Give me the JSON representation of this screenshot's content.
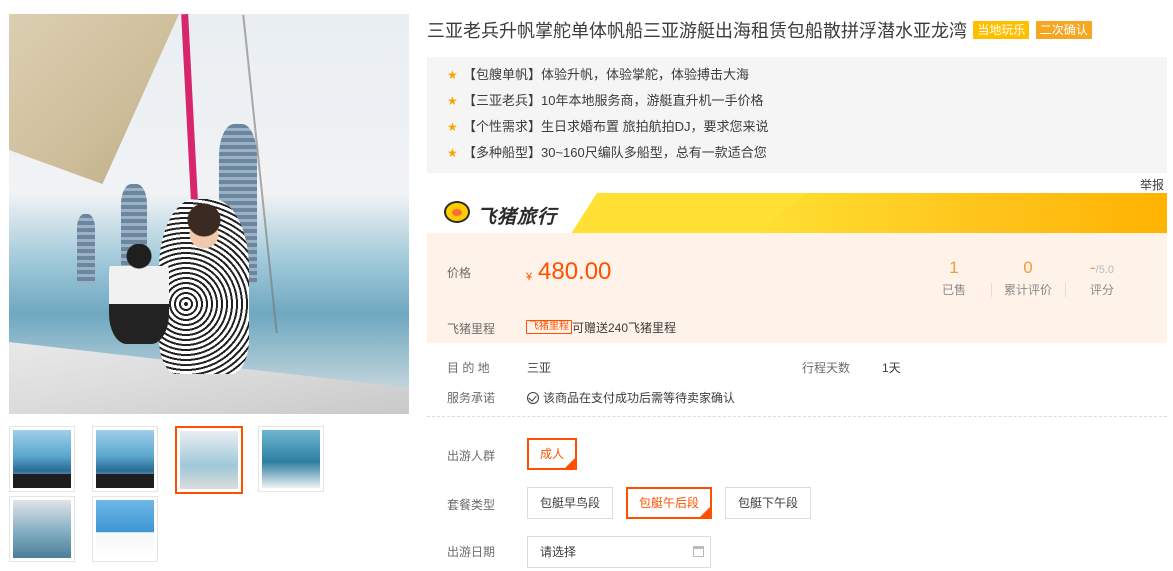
{
  "product": {
    "title": "三亚老兵升帆掌舵单体帆船三亚游艇出海租赁包船散拼浮潜水亚龙湾",
    "tags": [
      "当地玩乐",
      "二次确认"
    ]
  },
  "highlights": [
    "【包艘单帆】体验升帆，体验掌舵，体验搏击大海",
    "【三亚老兵】10年本地服务商，游艇直升机一手价格",
    "【个性需求】生日求婚布置 旅拍航拍DJ，要求您来说",
    "【多种船型】30~160尺编队多船型，总有一款适合您"
  ],
  "report_label": "举报",
  "brand": {
    "name": "飞猪旅行",
    "icon": "pig-logo-icon"
  },
  "price": {
    "label": "价格",
    "currency": "¥",
    "value": "480.00"
  },
  "stats": {
    "sold": {
      "value": "1",
      "label": "已售"
    },
    "reviews": {
      "value": "0",
      "label": "累计评价"
    },
    "rating": {
      "value": "-",
      "of": "/5.0",
      "label": "评分"
    }
  },
  "mileage": {
    "label": "飞猪里程",
    "badge": "飞猪里程",
    "text": "可赠送240飞猪里程"
  },
  "details": {
    "destination_label": "目 的 地",
    "destination": "三亚",
    "duration_label": "行程天数",
    "duration": "1天",
    "service_label": "服务承诺",
    "service": "该商品在支付成功后需等待卖家确认"
  },
  "options": {
    "crowd_label": "出游人群",
    "crowd": [
      "成人"
    ],
    "package_label": "套餐类型",
    "packages": [
      "包艇早鸟段",
      "包艇午后段",
      "包艇下午段"
    ],
    "selected_package": "包艇午后段",
    "date_label": "出游日期",
    "date_placeholder": "请选择"
  },
  "gallery": {
    "thumb_count": 6,
    "active_thumb": 3
  },
  "colors": {
    "accent": "#ff5000",
    "brand_yellow": "#ffe033",
    "tag_yellow": "#ffbf00"
  }
}
